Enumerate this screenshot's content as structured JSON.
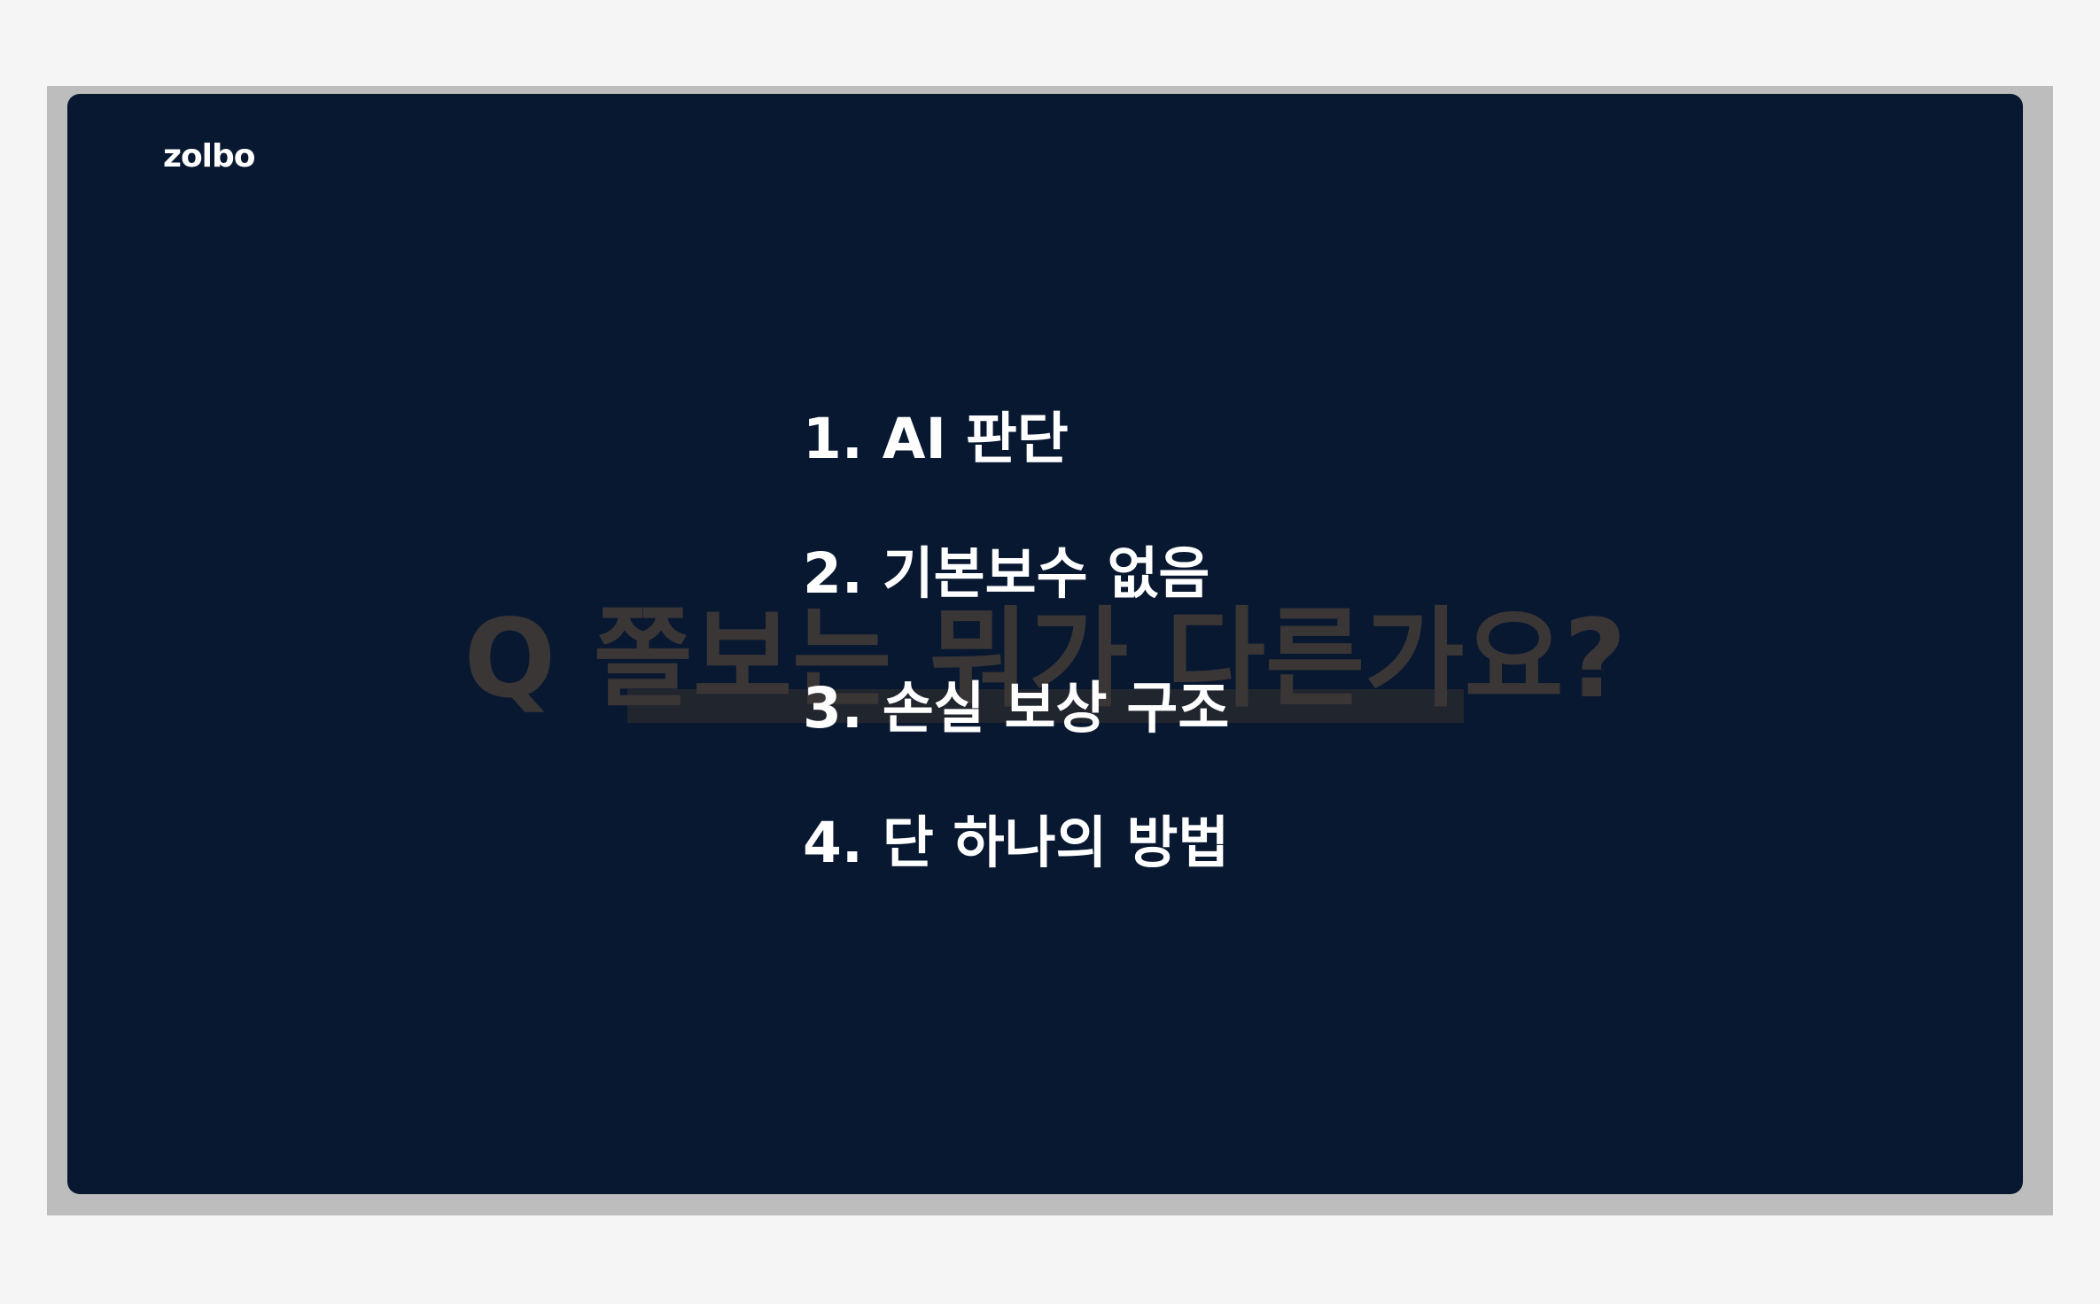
{
  "brand": {
    "logo": "zolbo"
  },
  "background_title": "Q 쫄보는 뭐가 다른가요?",
  "agenda": [
    {
      "label": "1.  AI 판단"
    },
    {
      "label": "2.  기본보수 없음"
    },
    {
      "label": "3.  손실 보상 구조"
    },
    {
      "label": "4.  단 하나의 방법"
    }
  ],
  "colors": {
    "slide_background": "#081831",
    "page_background": "#f5f5f5",
    "frame": "#bdbdbd",
    "text": "#ffffff",
    "ghost_title": "#3a3636"
  }
}
